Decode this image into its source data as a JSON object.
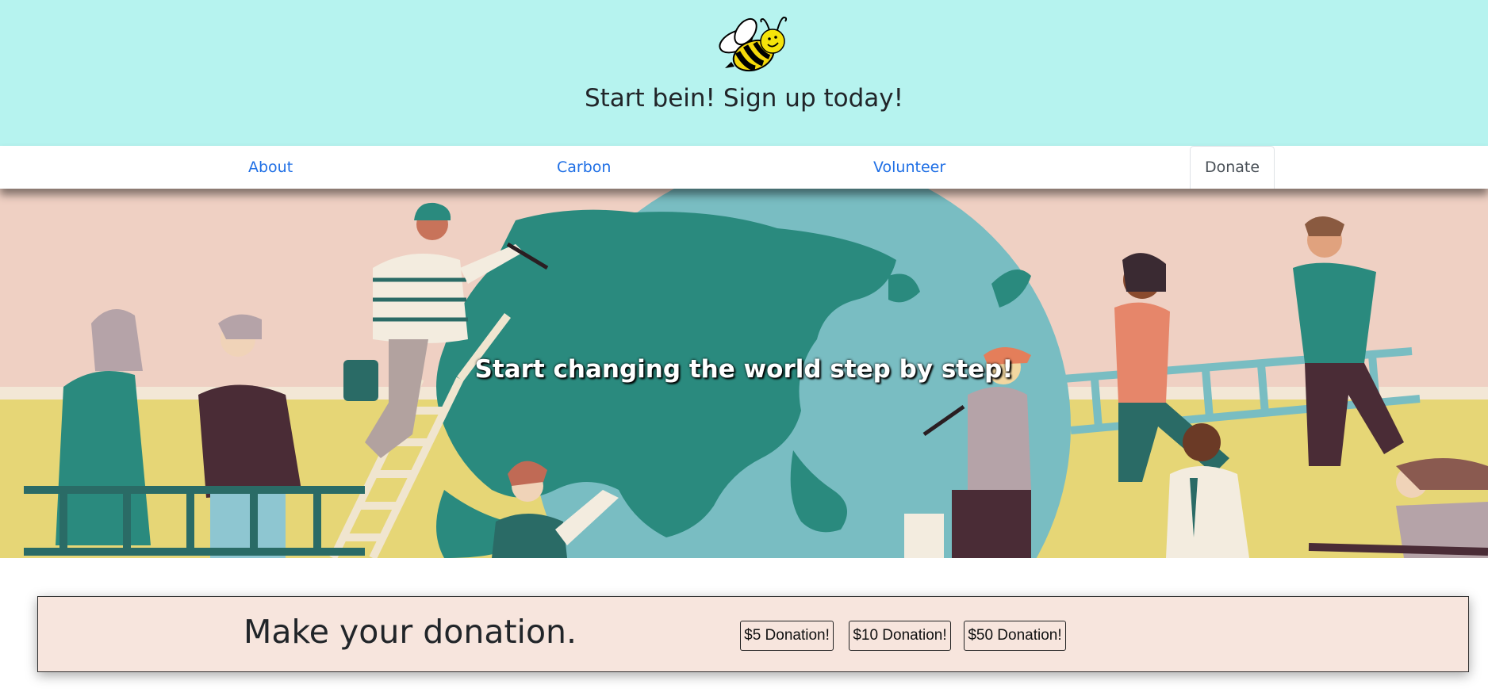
{
  "header": {
    "logo_icon": "bee-icon",
    "tagline": "Start bein! Sign up today!",
    "background": "#b6f3ef"
  },
  "nav": {
    "items": [
      {
        "label": "About"
      },
      {
        "label": "Carbon"
      },
      {
        "label": "Volunteer"
      },
      {
        "label": "Donate",
        "active": true
      }
    ],
    "link_color": "#1f6fe5"
  },
  "hero": {
    "caption": "Start changing the world step by step!",
    "image": "people-painting-globe-illustration"
  },
  "donation": {
    "title": "Make your donation.",
    "buttons": [
      {
        "label": "$5 Donation!"
      },
      {
        "label": "$10 Donation!"
      },
      {
        "label": "$50 Donation!"
      }
    ],
    "background": "#f7e5dd"
  }
}
